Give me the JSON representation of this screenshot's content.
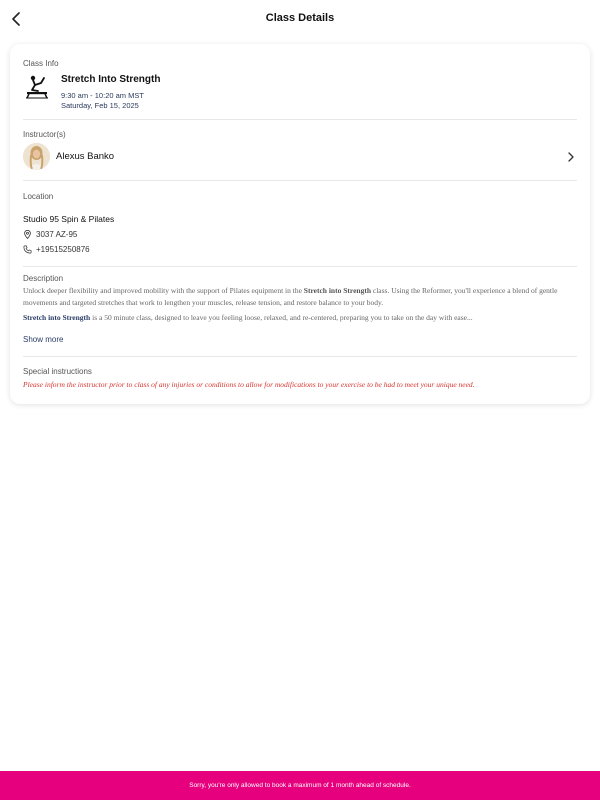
{
  "header": {
    "title": "Class Details",
    "back_icon": "chevron-left-icon"
  },
  "class_info": {
    "label": "Class Info",
    "name": "Stretch Into Strength",
    "time": "9:30 am - 10:20 am MST",
    "date": "Saturday, Feb 15, 2025",
    "icon": "pilates-reformer-icon"
  },
  "instructor": {
    "label": "Instructor(s)",
    "name": "Alexus Banko",
    "chevron_icon": "chevron-right-icon"
  },
  "location": {
    "label": "Location",
    "studio": "Studio 95 Spin & Pilates",
    "address": "3037 AZ-95",
    "phone": "+19515250876"
  },
  "description": {
    "label": "Description",
    "p1_a": "Unlock deeper flexibility and improved mobility with the support of Pilates equipment in the ",
    "p1_bold": "Stretch into Strength",
    "p1_b": " class. Using the Reformer, you'll experience a blend of gentle movements and targeted stretches that work to lengthen your muscles, release tension, and restore balance to your body.",
    "p2_bold": "Stretch into Strength",
    "p2_a": " is a 50 minute class, designed to leave you feeling loose, relaxed, and re-centered, preparing you to take on the day with ease...",
    "show_more": "Show more"
  },
  "special": {
    "label": "Special instructions",
    "text": "Please inform the instructor prior to class of any injuries or conditions to allow for modifications to your exercise to be had to meet your unique need."
  },
  "banner": {
    "text": "Sorry, you're only allowed to book a maximum of 1 month ahead of schedule.",
    "color": "#e6007e"
  }
}
